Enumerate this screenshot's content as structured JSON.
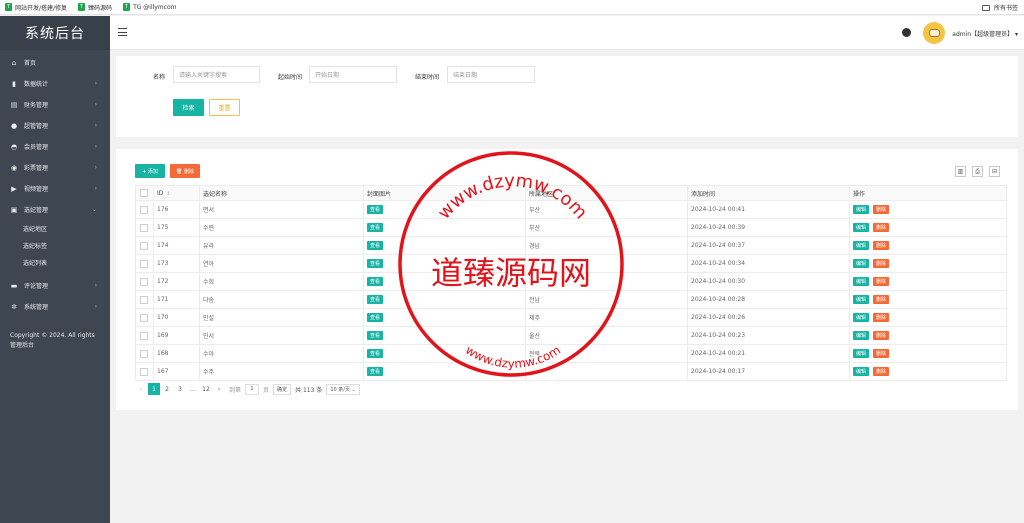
{
  "bookmarks": {
    "items": [
      {
        "icon": "T",
        "label": "网站开发/搭建/修复"
      },
      {
        "icon": "T",
        "label": "臻码源码"
      },
      {
        "icon": "T",
        "label": "TG @illymcom"
      }
    ],
    "all_bookmarks": "所有书签"
  },
  "sidebar": {
    "title": "系统后台",
    "items": [
      {
        "label": "首页",
        "icon": "home-icon",
        "glyph": "⌂",
        "arrow": ""
      },
      {
        "label": "数据统计",
        "icon": "bar-chart-icon",
        "glyph": "▮",
        "arrow": "›"
      },
      {
        "label": "财务管理",
        "icon": "finance-icon",
        "glyph": "▤",
        "arrow": "›"
      },
      {
        "label": "超管管理",
        "icon": "user-icon",
        "glyph": "●",
        "arrow": "›"
      },
      {
        "label": "会员管理",
        "icon": "users-icon",
        "glyph": "◓",
        "arrow": "›"
      },
      {
        "label": "彩票管理",
        "icon": "gamepad-icon",
        "glyph": "◉",
        "arrow": "›"
      },
      {
        "label": "视频管理",
        "icon": "video-icon",
        "glyph": "▶",
        "arrow": "›"
      },
      {
        "label": "选妃管理",
        "icon": "box-icon",
        "glyph": "▣",
        "arrow": "⌄"
      }
    ],
    "sub_items": [
      "选妃地区",
      "选妃标签",
      "选妃列表"
    ],
    "items_after": [
      {
        "label": "评论管理",
        "icon": "comment-icon",
        "glyph": "▬",
        "arrow": "›"
      },
      {
        "label": "系统管理",
        "icon": "gear-icon",
        "glyph": "✲",
        "arrow": "›"
      }
    ],
    "copyright": "Copyright © 2024. All rights 管理后台"
  },
  "header": {
    "user": "admin【超级管理员】 ▾"
  },
  "search": {
    "name_label": "名称",
    "name_placeholder": "请输入关键字搜索",
    "start_label": "起始时间",
    "start_placeholder": "开始日期",
    "end_label": "结束时间",
    "end_placeholder": "结束日期",
    "search_btn": "检索",
    "reset_btn": "重置"
  },
  "toolbar": {
    "add": "+ 添加",
    "delete": "🗑 删除"
  },
  "table": {
    "columns": [
      "ID",
      "选妃名称",
      "封面图片",
      "所属地区",
      "添加时间",
      "操作"
    ],
    "view_label": "查看",
    "edit_label": "编辑",
    "delete_label": "删除",
    "rows": [
      {
        "id": "176",
        "name": "면서",
        "region": "부산",
        "time": "2024-10-24 00:41"
      },
      {
        "id": "175",
        "name": "수련",
        "region": "부산",
        "time": "2024-10-24 00:39"
      },
      {
        "id": "174",
        "name": "유라",
        "region": "경남",
        "time": "2024-10-24 00:37"
      },
      {
        "id": "173",
        "name": "연아",
        "region": "",
        "time": "2024-10-24 00:34"
      },
      {
        "id": "172",
        "name": "수희",
        "region": "",
        "time": "2024-10-24 00:30"
      },
      {
        "id": "171",
        "name": "다솜",
        "region": "전남",
        "time": "2024-10-24 00:28"
      },
      {
        "id": "170",
        "name": "민설",
        "region": "제주",
        "time": "2024-10-24 00:26"
      },
      {
        "id": "169",
        "name": "민서",
        "region": "울산",
        "time": "2024-10-24 00:23"
      },
      {
        "id": "168",
        "name": "수아",
        "region": "전북",
        "time": "2024-10-24 00:21"
      },
      {
        "id": "167",
        "name": "수주",
        "region": "",
        "time": "2024-10-24 00:17"
      }
    ]
  },
  "pager": {
    "prev": "‹",
    "pages": [
      "1",
      "2",
      "3",
      "...",
      "12"
    ],
    "next": "›",
    "goto_label": "到第",
    "goto_value": "1",
    "page_unit": "页",
    "confirm": "确定",
    "total": "共 113 条",
    "page_size": "10 条/页 ⌄"
  },
  "watermark": {
    "top_text": "www.dzymw.com",
    "center_text": "道臻源码网",
    "bottom_text": "www.dzymw.com"
  }
}
